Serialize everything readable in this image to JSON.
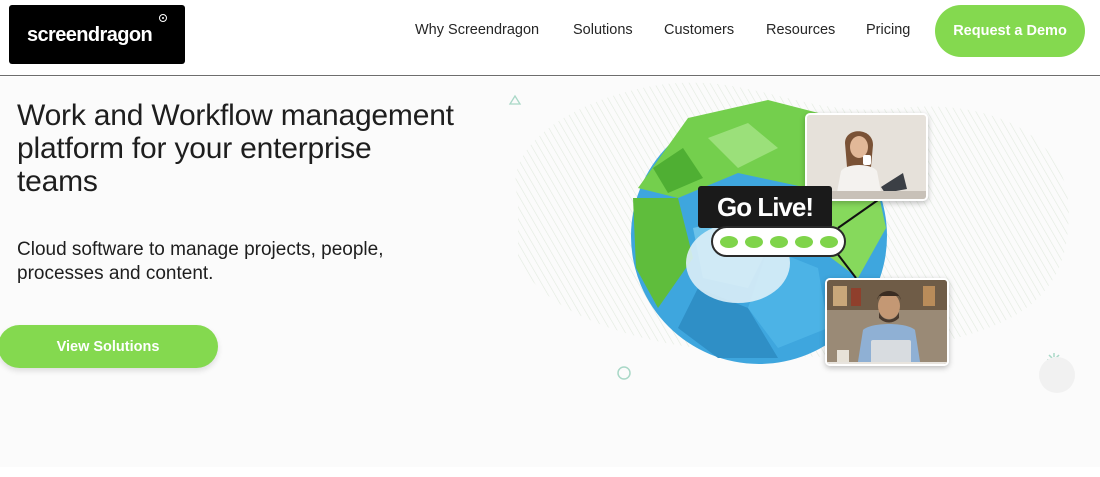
{
  "header": {
    "logo_text": "screendragon",
    "nav": {
      "why": "Why Screendragon",
      "solutions": "Solutions",
      "customers": "Customers",
      "resources": "Resources",
      "pricing": "Pricing"
    },
    "cta": "Request a Demo"
  },
  "hero": {
    "title": "Work and Workflow management platform for your enterprise teams",
    "subtitle": "Cloud software to manage projects, people, processes and content.",
    "button": "View Solutions",
    "badge": "Go Live!"
  },
  "colors": {
    "accent": "#84d94f",
    "globe_blue": "#3aa9e0",
    "globe_green": "#6fcf4a",
    "dark": "#1a1a1a"
  }
}
